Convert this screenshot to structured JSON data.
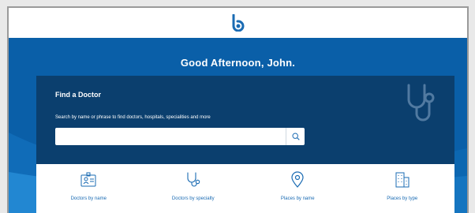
{
  "header": {
    "logo_icon": "b-logo-icon",
    "brand_color": "#1a6bb3"
  },
  "hero": {
    "greeting": "Good Afternoon, John.",
    "background_color": "#0a5fa8"
  },
  "find_doctor": {
    "title": "Find a Doctor",
    "description": "Search by name or phrase to find doctors, hospitals, specialities and more",
    "search": {
      "value": "",
      "placeholder": "",
      "button_icon": "search-icon"
    },
    "card_color": "#0b3f6e",
    "decor_icon": "stethoscope-icon"
  },
  "options": [
    {
      "label": "Doctors by name",
      "icon": "id-badge-icon"
    },
    {
      "label": "Doctors by specialty",
      "icon": "stethoscope-icon"
    },
    {
      "label": "Places by name",
      "icon": "map-pin-icon"
    },
    {
      "label": "Places by type",
      "icon": "building-icon"
    }
  ]
}
